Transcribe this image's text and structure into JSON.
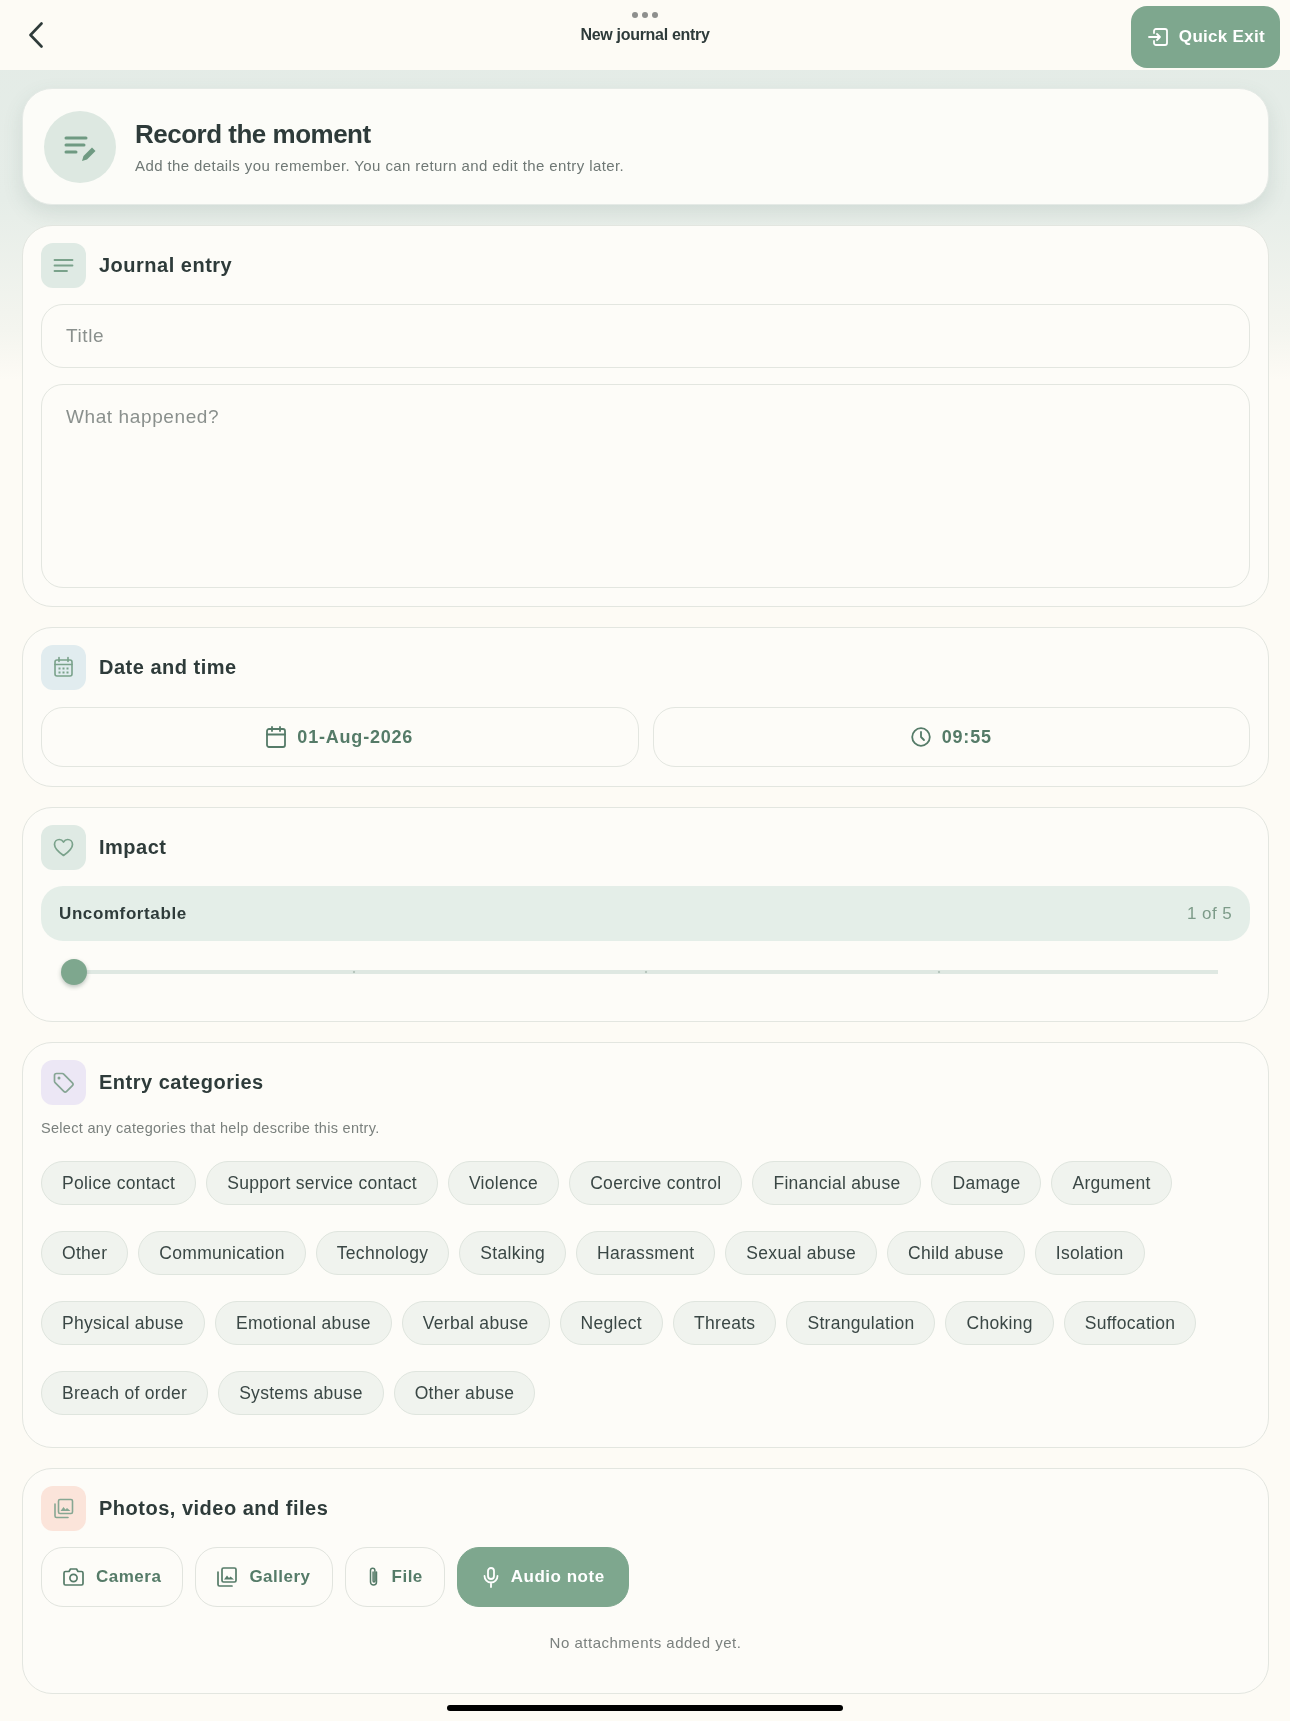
{
  "header": {
    "title": "New journal entry",
    "quick_exit": "Quick Exit"
  },
  "intro": {
    "title": "Record the moment",
    "subtitle": "Add the details you remember. You can return and edit the entry later."
  },
  "journal_entry": {
    "heading": "Journal entry",
    "title_field": {
      "placeholder": "Title"
    },
    "body_field": {
      "placeholder": "What happened?"
    }
  },
  "date_time": {
    "heading": "Date and time",
    "date": "01-Aug-2026",
    "time": "09:55"
  },
  "impact": {
    "heading": "Impact",
    "label": "Uncomfortable",
    "reading": "1 of 5",
    "level": 0
  },
  "categories": {
    "heading": "Entry categories",
    "hint": "Select any categories that help describe this entry.",
    "items": [
      {
        "label": "Police contact",
        "selected": false
      },
      {
        "label": "Support service contact",
        "selected": false
      },
      {
        "label": "Violence",
        "selected": false
      },
      {
        "label": "Coercive control",
        "selected": false
      },
      {
        "label": "Financial abuse",
        "selected": false
      },
      {
        "label": "Damage",
        "selected": false
      },
      {
        "label": "Argument",
        "selected": false
      },
      {
        "label": "Other",
        "selected": false
      },
      {
        "label": "Communication",
        "selected": false
      },
      {
        "label": "Technology",
        "selected": false
      },
      {
        "label": "Stalking",
        "selected": false
      },
      {
        "label": "Harassment",
        "selected": false
      },
      {
        "label": "Sexual abuse",
        "selected": false
      },
      {
        "label": "Child abuse",
        "selected": false
      },
      {
        "label": "Isolation",
        "selected": false
      },
      {
        "label": "Physical abuse",
        "selected": false
      },
      {
        "label": "Emotional abuse",
        "selected": false
      },
      {
        "label": "Verbal abuse",
        "selected": false
      },
      {
        "label": "Neglect",
        "selected": false
      },
      {
        "label": "Threats",
        "selected": false
      },
      {
        "label": "Strangulation",
        "selected": false
      },
      {
        "label": "Choking",
        "selected": false
      },
      {
        "label": "Suffocation",
        "selected": false
      },
      {
        "label": "Breach of order",
        "selected": false
      },
      {
        "label": "Systems abuse",
        "selected": false
      },
      {
        "label": "Other abuse",
        "selected": false
      }
    ]
  },
  "attachments": {
    "heading": "Photos, video and files",
    "buttons": [
      {
        "label": "Camera",
        "kind": "camera",
        "filled": false
      },
      {
        "label": "Gallery",
        "kind": "gallery",
        "filled": false
      },
      {
        "label": "File",
        "kind": "file",
        "filled": false
      },
      {
        "label": "Audio note",
        "kind": "audio",
        "filled": true
      }
    ],
    "empty_text": "No attachments added yet."
  }
}
